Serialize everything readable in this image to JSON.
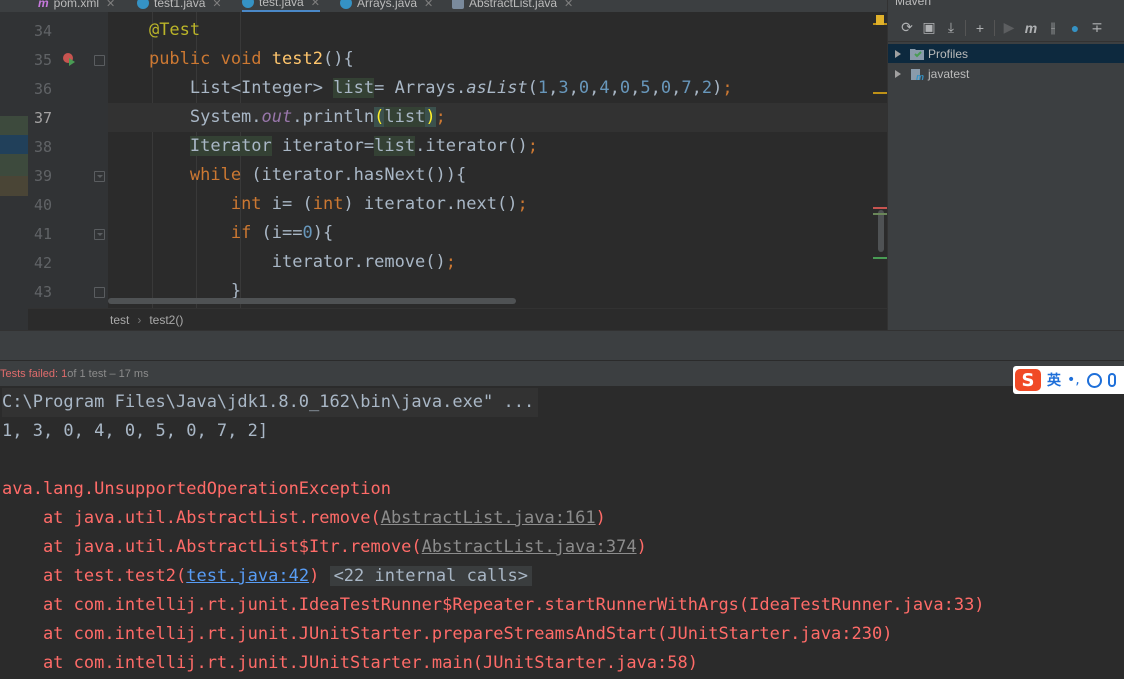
{
  "editor_tabs": [
    {
      "label": "pom.xml",
      "icon": "maven-icon"
    },
    {
      "label": "test1.java",
      "icon": "java-class-icon"
    },
    {
      "label": "test.java",
      "icon": "java-class-icon",
      "active": true
    },
    {
      "label": "Arrays.java",
      "icon": "java-class-icon"
    },
    {
      "label": "AbstractList.java",
      "icon": "java-abstract-icon"
    }
  ],
  "editor": {
    "line_numbers": [
      "34",
      "35",
      "36",
      "37",
      "38",
      "39",
      "40",
      "41",
      "42",
      "43"
    ],
    "current_line": "37"
  },
  "breadcrumb": {
    "class": "test",
    "method": "test2()"
  },
  "maven": {
    "title": "Maven",
    "tree": [
      {
        "label": "Profiles",
        "selected": true
      },
      {
        "label": "javatest",
        "selected": false
      }
    ]
  },
  "run": {
    "status_failed": "Tests failed: 1",
    "status_rest": " of 1 test – 17 ms",
    "command": "C:\\Program Files\\Java\\jdk1.8.0_162\\bin\\java.exe\" ...",
    "output": "1, 3, 0, 4, 0, 5, 0, 7, 2]",
    "exception": "ava.lang.UnsupportedOperationException",
    "stack": [
      {
        "prefix": "    at java.util.AbstractList.remove(",
        "link": "AbstractList.java:161",
        "suffix": ")"
      },
      {
        "prefix": "    at java.util.AbstractList$Itr.remove(",
        "link": "AbstractList.java:374",
        "suffix": ")"
      },
      {
        "prefix": "    at test.test2(",
        "link": "test.java:42",
        "suffix": ")",
        "folded": "<22 internal calls>"
      },
      {
        "prefix": "    at com.intellij.rt.junit.IdeaTestRunner$Repeater.startRunnerWithArgs(IdeaTestRunner.java:33)"
      },
      {
        "prefix": "    at com.intellij.rt.junit.JUnitStarter.prepareStreamsAndStart(JUnitStarter.java:230)"
      },
      {
        "prefix": "    at com.intellij.rt.junit.JUnitStarter.main(JUnitStarter.java:58)"
      }
    ]
  },
  "ime": {
    "logo": "S",
    "mode": "英",
    "punct": "•,"
  },
  "colors": {
    "background": "#2b2b2b",
    "keyword": "#cc7832",
    "annotation": "#bbb529",
    "method": "#ffc66d",
    "number": "#6897bb",
    "error": "#ff6b68",
    "link": "#589df6"
  }
}
